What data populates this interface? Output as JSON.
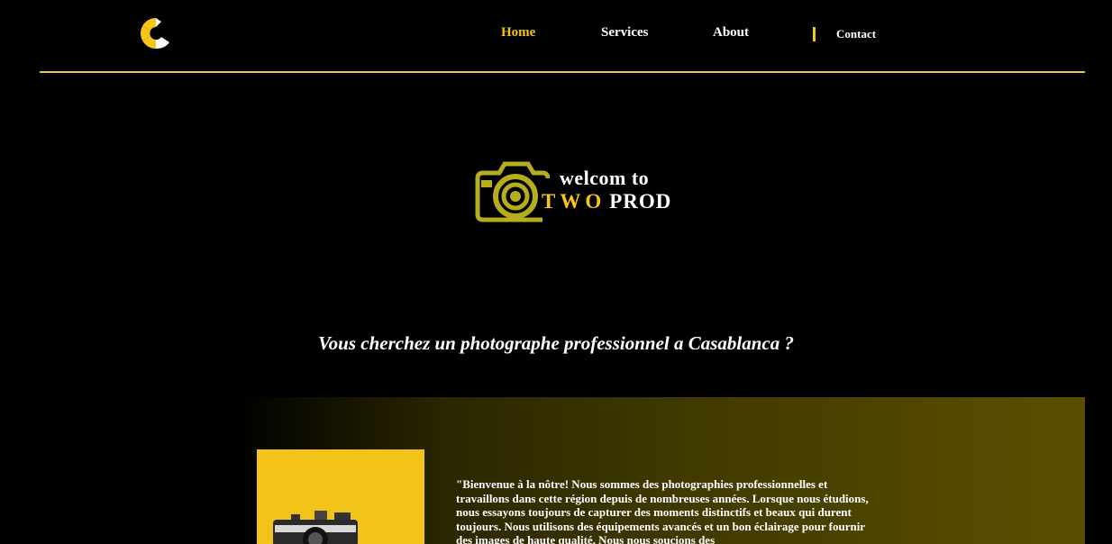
{
  "nav": {
    "logo_icon": "camera-shutter-logo-icon",
    "items": [
      {
        "label": "Home",
        "active": true
      },
      {
        "label": "Services",
        "active": false
      },
      {
        "label": "About",
        "active": false
      },
      {
        "label": "Contact",
        "active": false
      }
    ]
  },
  "hero": {
    "logo_icon": "camera-icon",
    "line1": "welcom to",
    "brand_part1": "TWO",
    "brand_part2": "PROD"
  },
  "tagline": "Vous cherchez un photographe professionnel a Casablanca ?",
  "about": {
    "photo_icon": "vintage-camera-photo",
    "text": "\"Bienvenue à la nôtre! Nous sommes des photographies professionnelles et travaillons dans cette région depuis de nombreuses années. Lorsque nous étudions, nous essayons toujours de capturer des moments distinctifs et beaux qui durent toujours. Nous utilisons des équipements avancés et un bon éclairage pour fournir des images de haute qualité. Nous nous soucions des"
  },
  "colors": {
    "accent": "#f5c518",
    "background": "#000000",
    "band_end": "#5a4f00",
    "logo_olive": "#b5ad1e"
  }
}
